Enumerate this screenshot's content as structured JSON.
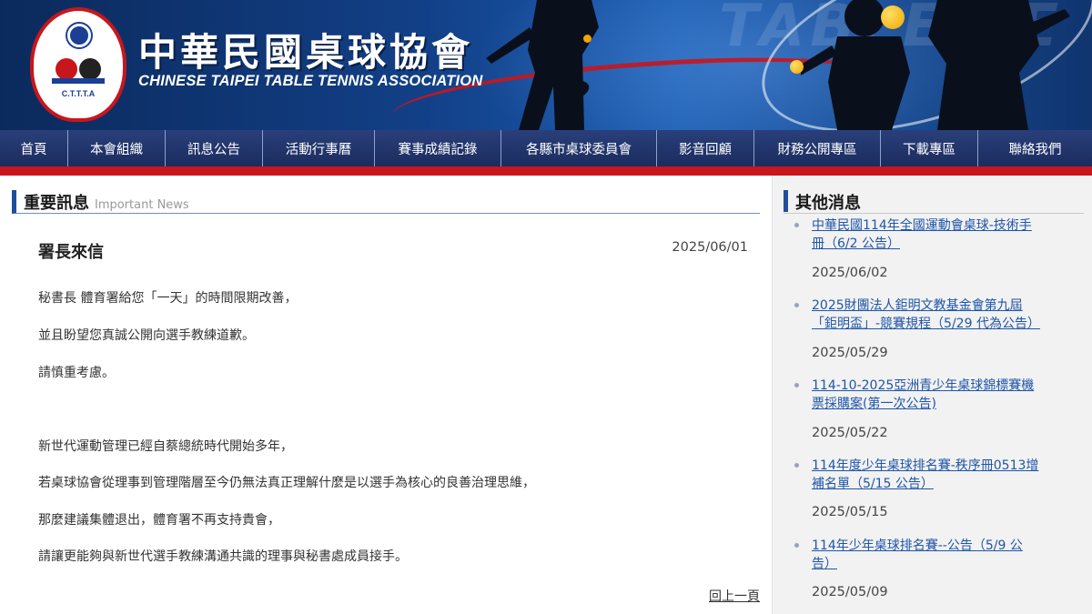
{
  "header": {
    "title_cn": "中華民國桌球協會",
    "title_en": "CHINESE TAIPEI TABLE TENNIS ASSOCIATION",
    "logo_text": "C.T.T.T.A",
    "banner_watermark": "TABLE TE",
    "colors": {
      "banner": "#123f86",
      "accent_red": "#c8161d",
      "nav": "#1b2c5e",
      "link": "#1f56a8"
    }
  },
  "nav": {
    "items": [
      {
        "label": "首頁"
      },
      {
        "label": "本會組織"
      },
      {
        "label": "訊息公告"
      },
      {
        "label": "活動行事曆"
      },
      {
        "label": "賽事成績記錄"
      },
      {
        "label": "各縣市桌球委員會"
      },
      {
        "label": "影音回顧"
      },
      {
        "label": "財務公開專區"
      },
      {
        "label": "下載專區"
      },
      {
        "label": "聯絡我們"
      }
    ]
  },
  "main": {
    "section_title": "重要訊息",
    "section_subtitle": "Important News",
    "article": {
      "title": "署長來信",
      "date": "2025/06/01",
      "paragraphs": [
        "秘書長 體育署給您「一天」的時間限期改善，",
        "並且盼望您真誠公開向選手教練道歉。",
        "請慎重考慮。",
        "新世代運動管理已經自蔡總統時代開始多年，",
        "若桌球協會從理事到管理階層至今仍無法真正理解什麼是以選手為核心的良善治理思維，",
        "那麼建議集體退出，體育署不再支持貴會，",
        "請讓更能夠與新世代選手教練溝通共識的理事與秘書處成員接手。"
      ]
    },
    "back_label": "回上一頁"
  },
  "sidebar": {
    "title": "其他消息",
    "news": [
      {
        "line1": "中華民國114年全國運動會桌球-技術手",
        "line2": "冊（6/2 公告）",
        "date": "2025/06/02"
      },
      {
        "line1": "2025財團法人鉅明文教基金會第九屆",
        "line2": "「鉅明盃」-競賽規程（5/29 代為公告）",
        "date": "2025/05/29"
      },
      {
        "line1": "114-10-2025亞洲青少年桌球錦標賽機",
        "line2": "票採購案(第一次公告)",
        "date": "2025/05/22"
      },
      {
        "line1": "114年度少年桌球排名賽-秩序冊0513增",
        "line2": "補名單（5/15 公告）",
        "date": "2025/05/15"
      },
      {
        "line1": "114年少年桌球排名賽--公告（5/9 公",
        "line2": "告）",
        "date": "2025/05/09"
      }
    ]
  }
}
